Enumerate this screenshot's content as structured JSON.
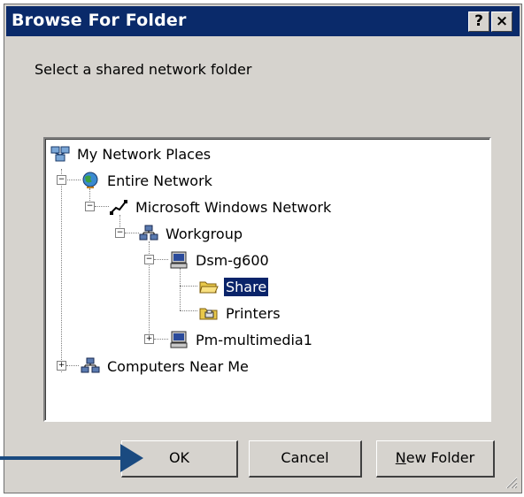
{
  "window": {
    "title": "Browse For Folder",
    "help_button": "?",
    "close_button": "×"
  },
  "instruction": "Select a shared network folder",
  "tree": {
    "nodes": [
      {
        "label": "My Network Places",
        "icon": "network-places-icon"
      },
      {
        "label": "Entire Network",
        "icon": "globe-icon",
        "expanded": true
      },
      {
        "label": "Microsoft Windows Network",
        "icon": "network-cable-icon",
        "expanded": true
      },
      {
        "label": "Workgroup",
        "icon": "workgroup-icon",
        "expanded": true
      },
      {
        "label": "Dsm-g600",
        "icon": "computer-icon",
        "expanded": true
      },
      {
        "label": "Share",
        "icon": "open-folder-icon",
        "selected": true
      },
      {
        "label": "Printers",
        "icon": "printers-folder-icon"
      },
      {
        "label": "Pm-multimedia1",
        "icon": "computer-icon",
        "expanded": false
      },
      {
        "label": "Computers Near Me",
        "icon": "workgroup-icon",
        "expanded": false
      }
    ]
  },
  "buttons": {
    "ok": "OK",
    "cancel": "Cancel",
    "new_folder_prefix": "N",
    "new_folder_rest": "ew Folder"
  },
  "colors": {
    "titlebar": "#0a2a6a",
    "selection": "#0a246a",
    "pointer_arrow": "#1a4a80"
  }
}
